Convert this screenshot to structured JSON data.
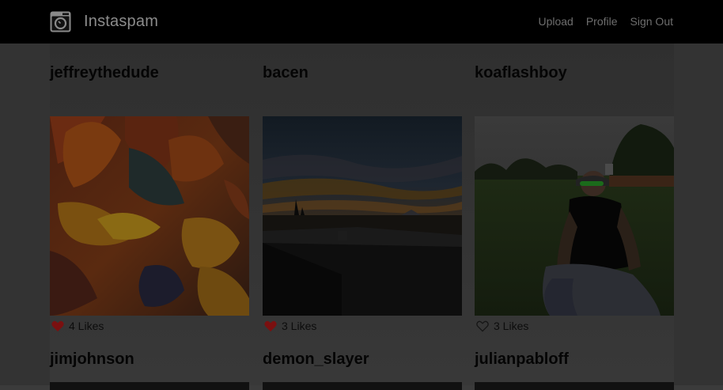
{
  "app": {
    "name": "Instaspam",
    "logo_icon": "camera-icon"
  },
  "nav": {
    "links": [
      "Upload",
      "Profile",
      "Sign Out"
    ]
  },
  "posts": [
    {
      "username": "jeffreythedude",
      "likes": "4 Likes",
      "liked": true,
      "image": "abstract orange and teal swirl"
    },
    {
      "username": "bacen",
      "likes": "3 Likes",
      "liked": true,
      "image": "sunset over rooftop with mountain"
    },
    {
      "username": "koaflashboy",
      "likes": "3 Likes",
      "liked": false,
      "image": "man in green sunglasses sitting on grass"
    },
    {
      "username": "jimjohnson"
    },
    {
      "username": "demon_slayer"
    },
    {
      "username": "julianpabloff"
    }
  ],
  "colors": {
    "heart_liked": "#7a1010",
    "heart_outline": "#151515"
  }
}
